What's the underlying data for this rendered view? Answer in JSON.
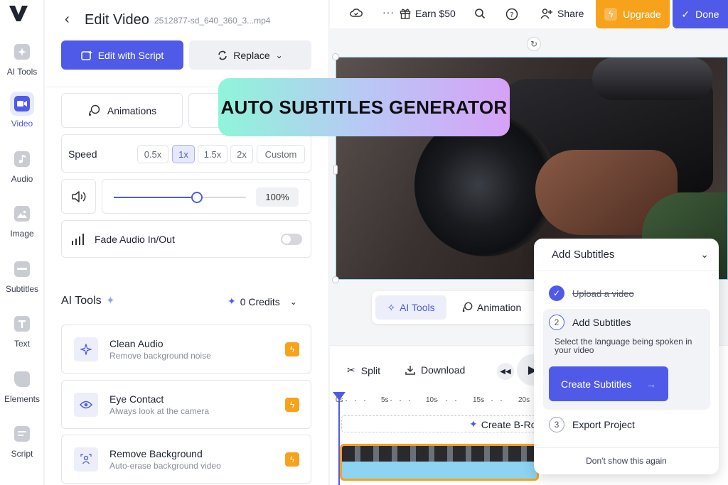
{
  "rail": {
    "items": [
      {
        "label": "AI Tools",
        "icon": "ai-tools-icon"
      },
      {
        "label": "Video",
        "icon": "video-icon",
        "active": true
      },
      {
        "label": "Audio",
        "icon": "audio-icon"
      },
      {
        "label": "Image",
        "icon": "image-icon"
      },
      {
        "label": "Subtitles",
        "icon": "subtitles-icon"
      },
      {
        "label": "Text",
        "icon": "text-icon"
      },
      {
        "label": "Elements",
        "icon": "elements-icon"
      },
      {
        "label": "Script",
        "icon": "script-icon"
      }
    ]
  },
  "panel": {
    "title": "Edit Video",
    "filename": "2512877-sd_640_360_3...mp4",
    "edit_script_label": "Edit with Script",
    "replace_label": "Replace",
    "animations_label": "Animations",
    "speed": {
      "label": "Speed",
      "options": [
        "0.5x",
        "1x",
        "1.5x",
        "2x",
        "Custom"
      ],
      "selected": "1x"
    },
    "volume": {
      "value_label": "100%",
      "fraction": 0.63
    },
    "fade_label": "Fade Audio In/Out",
    "ai_tools": {
      "title": "AI Tools",
      "credits_label": "0 Credits",
      "tools": [
        {
          "name": "Clean Audio",
          "desc": "Remove background noise",
          "icon": "sparkle-icon"
        },
        {
          "name": "Eye Contact",
          "desc": "Always look at the camera",
          "icon": "eye-icon"
        },
        {
          "name": "Remove Background",
          "desc": "Auto-erase background video",
          "icon": "person-cutout-icon"
        }
      ]
    }
  },
  "topbar": {
    "earn_label": "Earn $50",
    "share_label": "Share",
    "upgrade_label": "Upgrade",
    "done_label": "Done"
  },
  "banner": {
    "text": "AUTO SUBTITLES GENERATOR"
  },
  "floating_toolbar": {
    "ai_tools_label": "AI Tools",
    "animation_label": "Animation"
  },
  "timeline": {
    "split_label": "Split",
    "download_label": "Download",
    "ticks": [
      "0s",
      "5s",
      "10s",
      "15s",
      "20s"
    ],
    "broll_label": "Create B-Ro"
  },
  "subtitles_popover": {
    "title": "Add Subtitles",
    "step1": "Upload a video",
    "step2_num": "2",
    "step2": "Add Subtitles",
    "step2_desc": "Select the language being spoken in your video",
    "create_label": "Create Subtitles",
    "step3_num": "3",
    "step3": "Export Project",
    "dont_show": "Don't show this again"
  },
  "colors": {
    "accent": "#4f5be8",
    "upgrade": "#f7a21b"
  }
}
